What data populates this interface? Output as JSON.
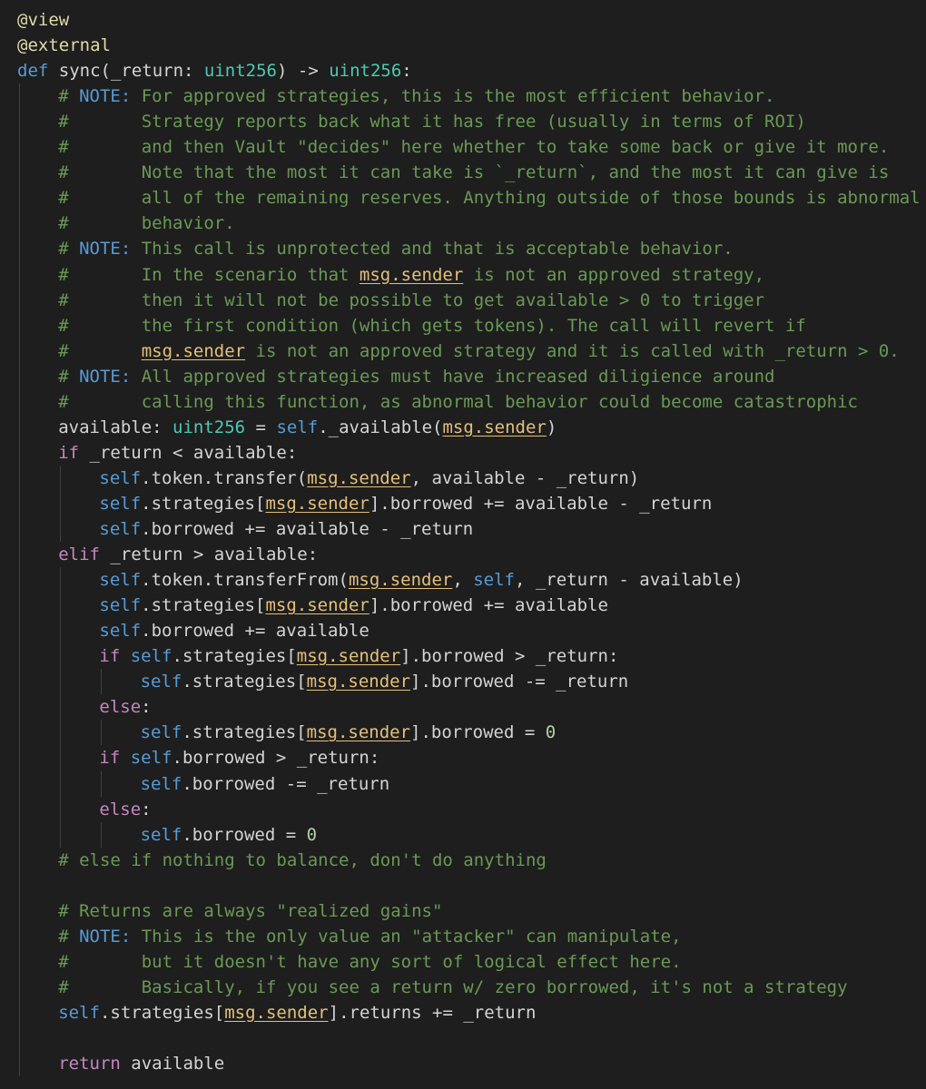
{
  "editor": {
    "language": "vyper",
    "lines": [
      {
        "indent": 0,
        "tokens": [
          {
            "t": "@view",
            "c": "dec"
          }
        ]
      },
      {
        "indent": 0,
        "tokens": [
          {
            "t": "@external",
            "c": "dec"
          }
        ]
      },
      {
        "indent": 0,
        "tokens": [
          {
            "t": "def",
            "c": "kw"
          },
          {
            "t": " sync(_return: ",
            "c": "id"
          },
          {
            "t": "uint256",
            "c": "type"
          },
          {
            "t": ") -> ",
            "c": "id"
          },
          {
            "t": "uint256",
            "c": "type"
          },
          {
            "t": ":",
            "c": "id"
          }
        ]
      },
      {
        "indent": 1,
        "tokens": [
          {
            "t": "# ",
            "c": "com"
          },
          {
            "t": "NOTE:",
            "c": "note"
          },
          {
            "t": " For approved strategies, this is the most efficient behavior.",
            "c": "com"
          }
        ]
      },
      {
        "indent": 1,
        "tokens": [
          {
            "t": "#       Strategy reports back what it has free (usually in terms of ROI)",
            "c": "com"
          }
        ]
      },
      {
        "indent": 1,
        "tokens": [
          {
            "t": "#       and then Vault \"decides\" here whether to take some back or give it more.",
            "c": "com"
          }
        ]
      },
      {
        "indent": 1,
        "tokens": [
          {
            "t": "#       Note that the most it can take is `_return`, and the most it can give is",
            "c": "com"
          }
        ]
      },
      {
        "indent": 1,
        "tokens": [
          {
            "t": "#       all of the remaining reserves. Anything outside of those bounds is abnormal",
            "c": "com"
          }
        ]
      },
      {
        "indent": 1,
        "tokens": [
          {
            "t": "#       behavior.",
            "c": "com"
          }
        ]
      },
      {
        "indent": 1,
        "tokens": [
          {
            "t": "# ",
            "c": "com"
          },
          {
            "t": "NOTE:",
            "c": "note"
          },
          {
            "t": " This call is unprotected and that is acceptable behavior.",
            "c": "com"
          }
        ]
      },
      {
        "indent": 1,
        "tokens": [
          {
            "t": "#       In the scenario that ",
            "c": "com"
          },
          {
            "t": "msg.sender",
            "c": "hl"
          },
          {
            "t": " is not an approved strategy,",
            "c": "com"
          }
        ]
      },
      {
        "indent": 1,
        "tokens": [
          {
            "t": "#       then it will not be possible to get available > 0 to trigger",
            "c": "com"
          }
        ]
      },
      {
        "indent": 1,
        "tokens": [
          {
            "t": "#       the first condition (which gets tokens). The call will revert if",
            "c": "com"
          }
        ]
      },
      {
        "indent": 1,
        "tokens": [
          {
            "t": "#       ",
            "c": "com"
          },
          {
            "t": "msg.sender",
            "c": "hl"
          },
          {
            "t": " is not an approved strategy and it is called with _return > 0.",
            "c": "com"
          }
        ]
      },
      {
        "indent": 1,
        "tokens": [
          {
            "t": "# ",
            "c": "com"
          },
          {
            "t": "NOTE:",
            "c": "note"
          },
          {
            "t": " All approved strategies must have increased diligience around",
            "c": "com"
          }
        ]
      },
      {
        "indent": 1,
        "tokens": [
          {
            "t": "#       calling this function, as abnormal behavior could become catastrophic",
            "c": "com"
          }
        ]
      },
      {
        "indent": 1,
        "tokens": [
          {
            "t": "available: ",
            "c": "id"
          },
          {
            "t": "uint256",
            "c": "type"
          },
          {
            "t": " = ",
            "c": "id"
          },
          {
            "t": "self",
            "c": "self"
          },
          {
            "t": "._available(",
            "c": "id"
          },
          {
            "t": "msg.sender",
            "c": "hl"
          },
          {
            "t": ")",
            "c": "id"
          }
        ]
      },
      {
        "indent": 1,
        "tokens": [
          {
            "t": "if",
            "c": "ctl"
          },
          {
            "t": " _return < available:",
            "c": "id"
          }
        ]
      },
      {
        "indent": 2,
        "tokens": [
          {
            "t": "self",
            "c": "self"
          },
          {
            "t": ".token.transfer(",
            "c": "id"
          },
          {
            "t": "msg.sender",
            "c": "hl"
          },
          {
            "t": ", available - _return)",
            "c": "id"
          }
        ]
      },
      {
        "indent": 2,
        "tokens": [
          {
            "t": "self",
            "c": "self"
          },
          {
            "t": ".strategies[",
            "c": "id"
          },
          {
            "t": "msg.sender",
            "c": "hl"
          },
          {
            "t": "].borrowed += available - _return",
            "c": "id"
          }
        ]
      },
      {
        "indent": 2,
        "tokens": [
          {
            "t": "self",
            "c": "self"
          },
          {
            "t": ".borrowed += available - _return",
            "c": "id"
          }
        ]
      },
      {
        "indent": 1,
        "tokens": [
          {
            "t": "elif",
            "c": "ctl"
          },
          {
            "t": " _return > available:",
            "c": "id"
          }
        ]
      },
      {
        "indent": 2,
        "tokens": [
          {
            "t": "self",
            "c": "self"
          },
          {
            "t": ".token.transferFrom(",
            "c": "id"
          },
          {
            "t": "msg.sender",
            "c": "hl"
          },
          {
            "t": ", ",
            "c": "id"
          },
          {
            "t": "self",
            "c": "self"
          },
          {
            "t": ", _return - available)",
            "c": "id"
          }
        ]
      },
      {
        "indent": 2,
        "tokens": [
          {
            "t": "self",
            "c": "self"
          },
          {
            "t": ".strategies[",
            "c": "id"
          },
          {
            "t": "msg.sender",
            "c": "hl"
          },
          {
            "t": "].borrowed += available",
            "c": "id"
          }
        ]
      },
      {
        "indent": 2,
        "tokens": [
          {
            "t": "self",
            "c": "self"
          },
          {
            "t": ".borrowed += available",
            "c": "id"
          }
        ]
      },
      {
        "indent": 2,
        "tokens": [
          {
            "t": "if",
            "c": "ctl"
          },
          {
            "t": " ",
            "c": "id"
          },
          {
            "t": "self",
            "c": "self"
          },
          {
            "t": ".strategies[",
            "c": "id"
          },
          {
            "t": "msg.sender",
            "c": "hl"
          },
          {
            "t": "].borrowed > _return:",
            "c": "id"
          }
        ]
      },
      {
        "indent": 3,
        "tokens": [
          {
            "t": "self",
            "c": "self"
          },
          {
            "t": ".strategies[",
            "c": "id"
          },
          {
            "t": "msg.sender",
            "c": "hl"
          },
          {
            "t": "].borrowed -= _return",
            "c": "id"
          }
        ]
      },
      {
        "indent": 2,
        "tokens": [
          {
            "t": "else",
            "c": "ctl"
          },
          {
            "t": ":",
            "c": "id"
          }
        ]
      },
      {
        "indent": 3,
        "tokens": [
          {
            "t": "self",
            "c": "self"
          },
          {
            "t": ".strategies[",
            "c": "id"
          },
          {
            "t": "msg.sender",
            "c": "hl"
          },
          {
            "t": "].borrowed = ",
            "c": "id"
          },
          {
            "t": "0",
            "c": "num"
          }
        ]
      },
      {
        "indent": 2,
        "tokens": [
          {
            "t": "if",
            "c": "ctl"
          },
          {
            "t": " ",
            "c": "id"
          },
          {
            "t": "self",
            "c": "self"
          },
          {
            "t": ".borrowed > _return:",
            "c": "id"
          }
        ]
      },
      {
        "indent": 3,
        "tokens": [
          {
            "t": "self",
            "c": "self"
          },
          {
            "t": ".borrowed -= _return",
            "c": "id"
          }
        ]
      },
      {
        "indent": 2,
        "tokens": [
          {
            "t": "else",
            "c": "ctl"
          },
          {
            "t": ":",
            "c": "id"
          }
        ]
      },
      {
        "indent": 3,
        "tokens": [
          {
            "t": "self",
            "c": "self"
          },
          {
            "t": ".borrowed = ",
            "c": "id"
          },
          {
            "t": "0",
            "c": "num"
          }
        ]
      },
      {
        "indent": 1,
        "tokens": [
          {
            "t": "# else if nothing to balance, don't do anything",
            "c": "com"
          }
        ]
      },
      {
        "indent": 1,
        "tokens": []
      },
      {
        "indent": 1,
        "tokens": [
          {
            "t": "# Returns are always \"realized gains\"",
            "c": "com"
          }
        ]
      },
      {
        "indent": 1,
        "tokens": [
          {
            "t": "# ",
            "c": "com"
          },
          {
            "t": "NOTE:",
            "c": "note"
          },
          {
            "t": " This is the only value an \"attacker\" can manipulate,",
            "c": "com"
          }
        ]
      },
      {
        "indent": 1,
        "tokens": [
          {
            "t": "#       but it doesn't have any sort of logical effect here.",
            "c": "com"
          }
        ]
      },
      {
        "indent": 1,
        "tokens": [
          {
            "t": "#       Basically, if you see a return w/ zero borrowed, it's not a strategy",
            "c": "com"
          }
        ]
      },
      {
        "indent": 1,
        "tokens": [
          {
            "t": "self",
            "c": "self"
          },
          {
            "t": ".strategies[",
            "c": "id"
          },
          {
            "t": "msg.sender",
            "c": "hl"
          },
          {
            "t": "].returns += _return",
            "c": "id"
          }
        ]
      },
      {
        "indent": 1,
        "tokens": []
      },
      {
        "indent": 1,
        "tokens": [
          {
            "t": "return",
            "c": "ctl"
          },
          {
            "t": " available",
            "c": "id"
          }
        ]
      }
    ],
    "indent_guides": [
      {
        "level": 1,
        "from": 3,
        "to": 41
      },
      {
        "level": 2,
        "from": 18,
        "to": 20
      },
      {
        "level": 2,
        "from": 22,
        "to": 32
      },
      {
        "level": 3,
        "from": 26,
        "to": 26
      },
      {
        "level": 3,
        "from": 28,
        "to": 28
      },
      {
        "level": 3,
        "from": 30,
        "to": 30
      },
      {
        "level": 3,
        "from": 32,
        "to": 32
      }
    ]
  }
}
